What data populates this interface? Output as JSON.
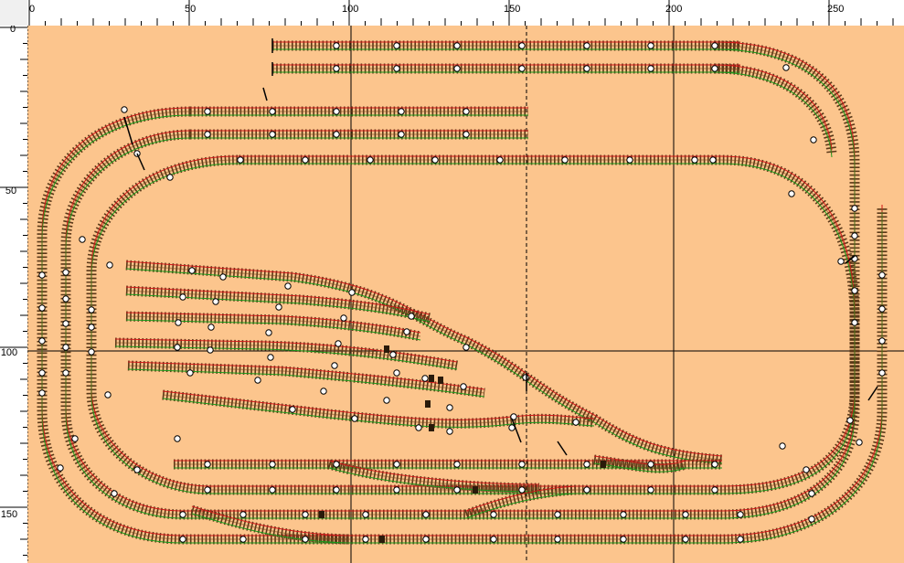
{
  "ruler": {
    "x_labels": [
      "0",
      "50",
      "100",
      "150",
      "200",
      "250"
    ],
    "y_labels": [
      "0",
      "50",
      "100",
      "150"
    ]
  },
  "colors": {
    "background": "#fcc58d",
    "ties": "#5a3818",
    "rail_left": "#d01818",
    "rail_right": "#1a9a1a",
    "guide_line": "#000000"
  },
  "layout_name": "",
  "icons": [
    "track-segment",
    "connector-node",
    "turnout-marker"
  ]
}
